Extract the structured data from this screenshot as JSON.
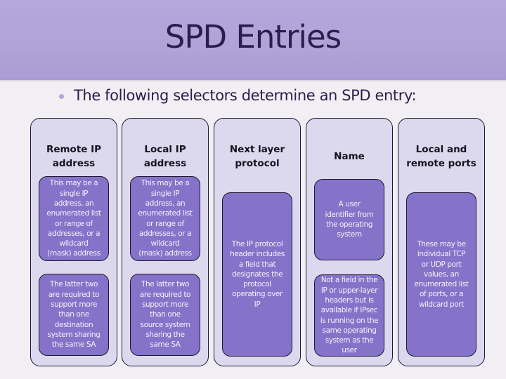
{
  "slide": {
    "title": "SPD Entries",
    "bullet": "The following selectors determine an SPD entry:"
  },
  "columns": [
    {
      "heading": "Remote IP\naddress",
      "boxes": [
        "This may be a\nsingle IP\naddress, an\nenumerated list\nor range of\naddresses, or a\nwildcard\n(mask) address",
        "The latter two\nare required to\nsupport more\nthan one\ndestination\nsystem sharing\nthe same SA"
      ]
    },
    {
      "heading": "Local IP\naddress",
      "boxes": [
        "This may be a\nsingle IP\naddress, an\nenumerated list\nor range of\naddresses, or a\nwildcard\n(mask) address",
        "The latter two\nare required to\nsupport more\nthan one\nsource system\nsharing the\nsame SA"
      ]
    },
    {
      "heading": "Next layer\nprotocol",
      "boxes": [
        "The IP protocol\nheader includes\na field that\ndesignates the\nprotocol\noperating over\nIP"
      ]
    },
    {
      "heading": "Name",
      "boxes": [
        "A user\nidentifier from\nthe operating\nsystem",
        "Not a field in the\nIP or upper-layer\nheaders but is\navailable if IPsec\nis running on the\nsame operating\nsystem as the\nuser"
      ]
    },
    {
      "heading": "Local and\nremote ports",
      "boxes": [
        "These may be\nindividual TCP\nor UDP port\nvalues, an\nenumerated list\nof ports, or a\nwildcard port"
      ]
    }
  ],
  "colors": {
    "title_band": "#b2a2d8",
    "title_text": "#2b1e4d",
    "column_fill": "#dcd8ee",
    "inner_box_fill": "#8473c9",
    "bullet_dot": "#b4a5da"
  }
}
